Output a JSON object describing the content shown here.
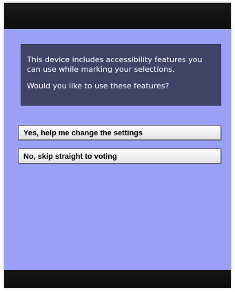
{
  "dialog": {
    "message_line1": "This device includes accessibility features you can use while marking your selections.",
    "message_line2": "Would you like to use these features?"
  },
  "options": {
    "yes_label": "Yes, help me change the settings",
    "no_label": "No, skip straight to voting"
  },
  "colors": {
    "screen_background": "#9aa0f8",
    "message_background": "#3f4566",
    "bars": "#111111"
  }
}
